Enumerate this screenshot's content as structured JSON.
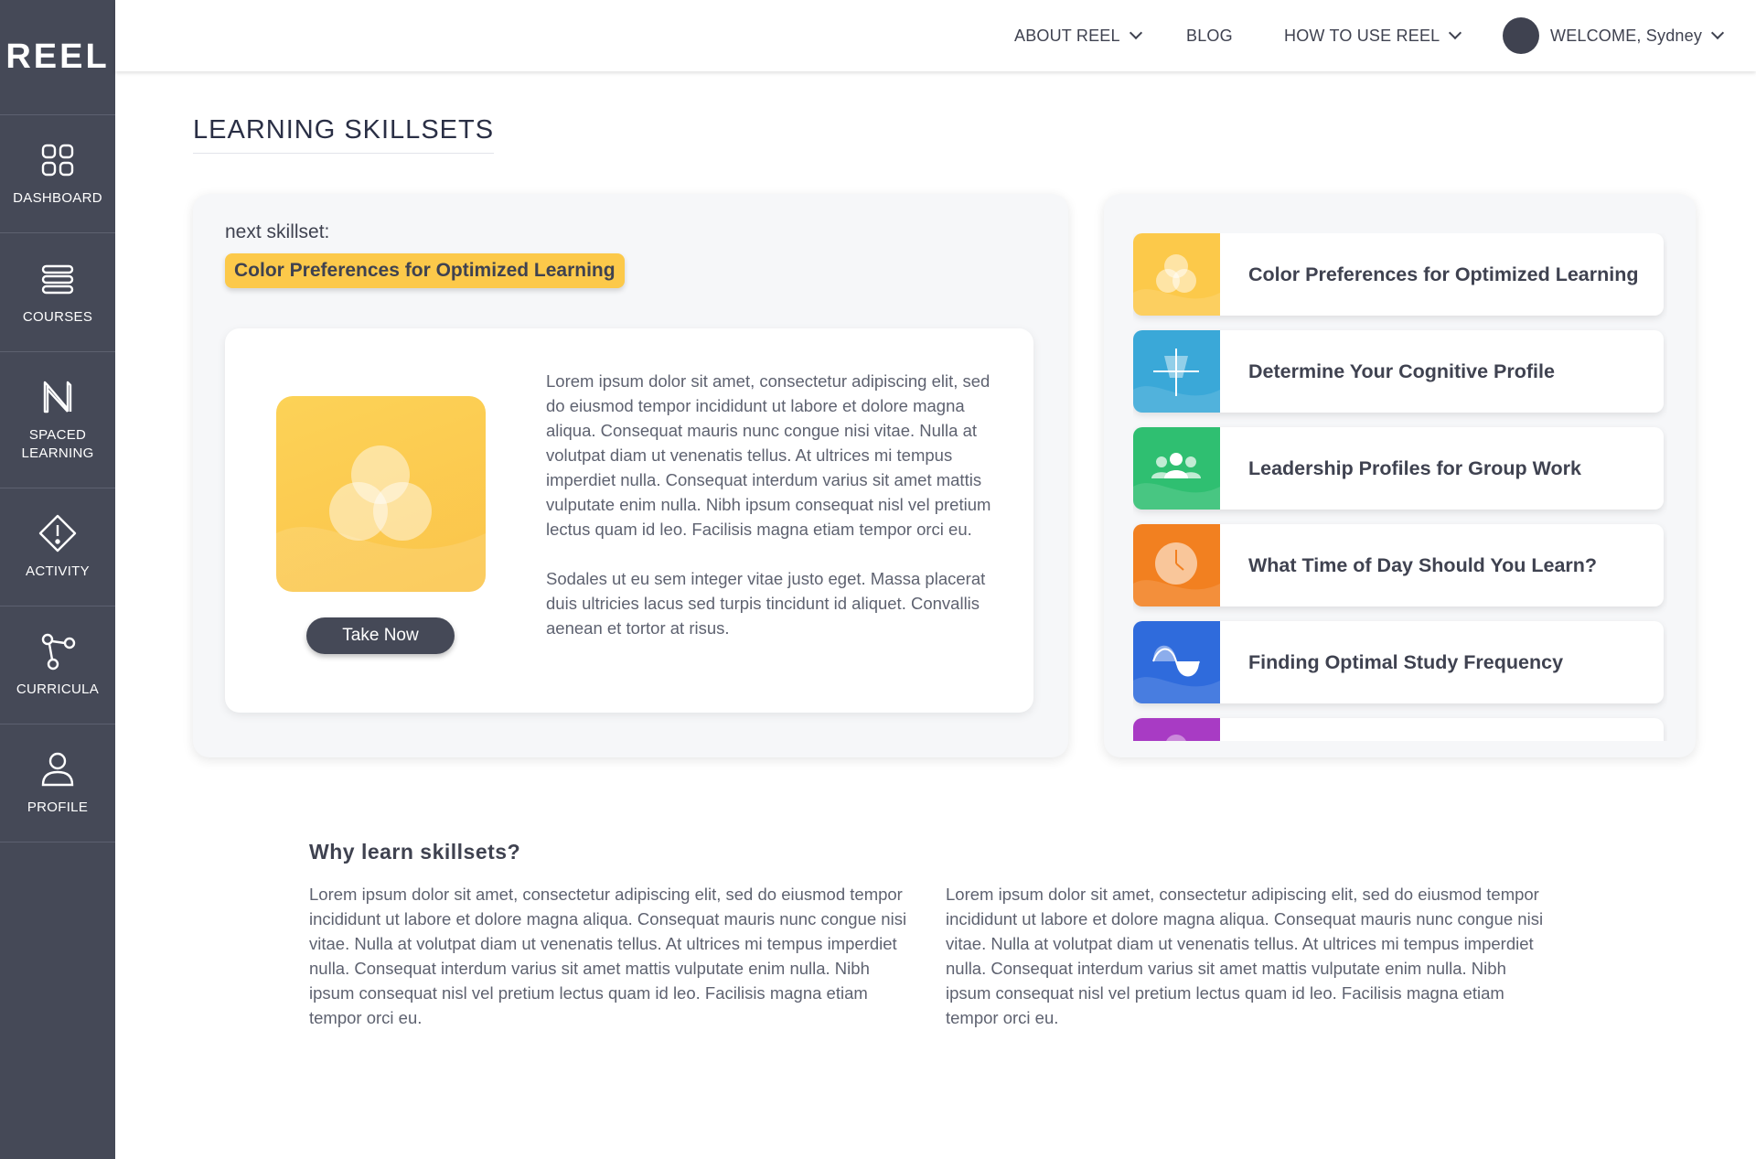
{
  "app": {
    "logo": "REEL"
  },
  "sidebar": {
    "items": [
      {
        "label": "DASHBOARD",
        "icon": "grid-icon"
      },
      {
        "label": "COURSES",
        "icon": "list-icon"
      },
      {
        "label": "SPACED LEARNING",
        "icon": "spaced-learning-icon"
      },
      {
        "label": "ACTIVITY",
        "icon": "alert-diamond-icon"
      },
      {
        "label": "CURRICULA",
        "icon": "branch-icon"
      },
      {
        "label": "PROFILE",
        "icon": "user-icon"
      }
    ]
  },
  "topnav": {
    "about": "ABOUT REEL",
    "blog": "BLOG",
    "howto": "HOW TO USE REEL",
    "welcome": "WELCOME, Sydney"
  },
  "page": {
    "title": "LEARNING SKILLSETS"
  },
  "next": {
    "label": "next skillset:",
    "skill": "Color Preferences for Optimized Learning",
    "button": "Take Now",
    "paragraph1": "Lorem ipsum dolor sit amet, consectetur adipiscing elit, sed do eiusmod tempor incididunt ut labore et dolore magna aliqua. Consequat mauris nunc congue nisi vitae. Nulla at volutpat diam ut venenatis tellus. At ultrices mi tempus imperdiet nulla. Consequat interdum varius sit amet mattis vulputate enim nulla. Nibh ipsum consequat nisl vel pretium lectus quam id leo. Facilisis magna etiam tempor orci eu.",
    "paragraph2": "Sodales ut eu sem integer vitae justo eget. Massa placerat duis ultricies lacus sed turpis tincidunt id aliquet. Convallis aenean et tortor at risus."
  },
  "skills": [
    {
      "name": "Color Preferences for Optimized Learning",
      "color": "#fcc94a",
      "icon": "color-circles-icon"
    },
    {
      "name": "Determine Your Cognitive Profile",
      "color": "#3aa8d8",
      "icon": "cognitive-icon"
    },
    {
      "name": "Leadership Profiles for Group Work",
      "color": "#2fbf71",
      "icon": "group-icon"
    },
    {
      "name": "What Time of Day Should You Learn?",
      "color": "#f28020",
      "icon": "clock-icon"
    },
    {
      "name": "Finding Optimal Study Frequency",
      "color": "#2f6bdc",
      "icon": "wave-icon"
    },
    {
      "name": "",
      "color": "#a83bc4",
      "icon": "partial-icon"
    }
  ],
  "why": {
    "title": "Why learn skillsets?",
    "col1": "Lorem ipsum dolor sit amet, consectetur adipiscing elit, sed do eiusmod tempor incididunt ut labore et dolore magna aliqua. Consequat mauris nunc congue nisi vitae. Nulla at volutpat diam ut venenatis tellus. At ultrices mi tempus imperdiet nulla. Consequat interdum varius sit amet mattis vulputate enim nulla. Nibh ipsum consequat nisl vel pretium lectus quam id leo. Facilisis magna etiam tempor orci eu.",
    "col2": "Lorem ipsum dolor sit amet, consectetur adipiscing elit, sed do eiusmod tempor incididunt ut labore et dolore magna aliqua. Consequat mauris nunc congue nisi vitae. Nulla at volutpat diam ut venenatis tellus. At ultrices mi tempus imperdiet nulla. Consequat interdum varius sit amet mattis vulputate enim nulla. Nibh ipsum consequat nisl vel pretium lectus quam id leo. Facilisis magna etiam tempor orci eu."
  }
}
